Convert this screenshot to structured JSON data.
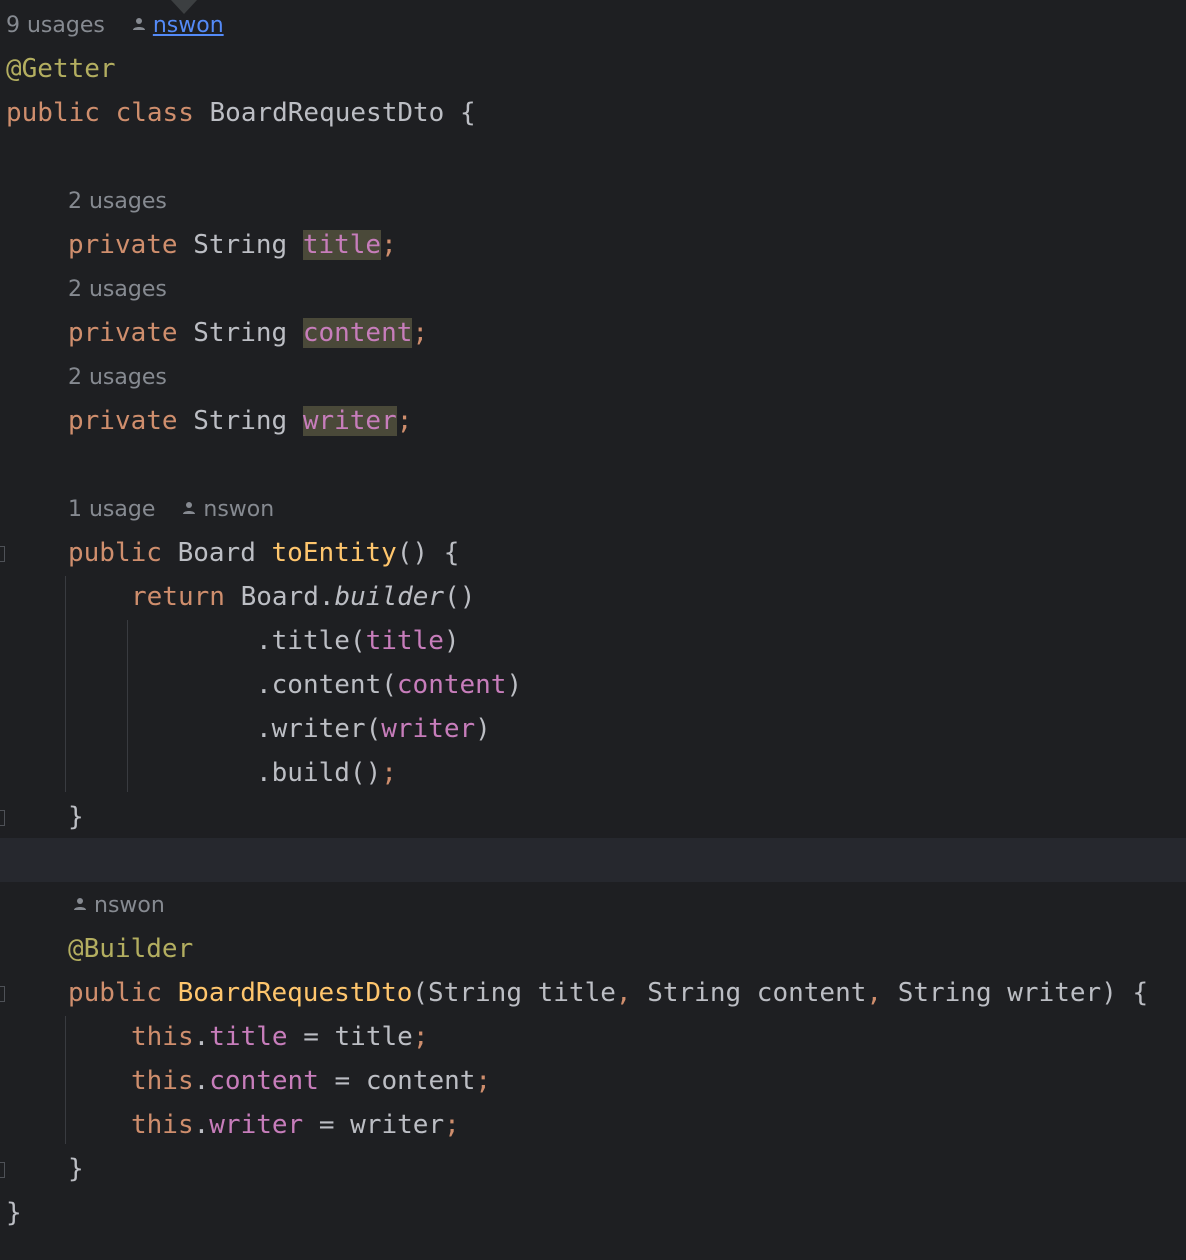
{
  "editor": {
    "colors": {
      "background": "#1e1f22",
      "keyword": "#cf8e6d",
      "annotation": "#b3ae60",
      "field": "#c77dbb",
      "method_declaration": "#ffc66d",
      "default_text": "#bcbec4",
      "hint_text": "#868a91",
      "link": "#548af7"
    },
    "hints": {
      "class_usages": "9 usages",
      "class_author": "nswon",
      "title_usages": "2 usages",
      "content_usages": "2 usages",
      "writer_usages": "2 usages",
      "toEntity_usages": "1 usage",
      "toEntity_author": "nswon",
      "constructor_author": "nswon"
    },
    "code": {
      "getter_annotation": "@Getter",
      "kw_public": "public",
      "kw_class": "class",
      "class_name": "BoardRequestDto",
      "open_brace": "{",
      "close_brace": "}",
      "kw_private": "private",
      "type_string": "String",
      "field_title": "title",
      "field_content": "content",
      "field_writer": "writer",
      "semicolon": ";",
      "type_board": "Board",
      "method_toEntity": "toEntity",
      "empty_parens": "()",
      "kw_return": "return",
      "board_builder_prefix": "Board.",
      "builder_call": "builder",
      "dot_title": ".title(",
      "dot_content": ".content(",
      "dot_writer": ".writer(",
      "close_paren": ")",
      "dot_build": ".build()",
      "builder_annotation": "@Builder",
      "ctor_open_paren": "(",
      "param_title": "title",
      "param_content": "content",
      "param_writer": "writer",
      "comma": ",",
      "ctor_close": ") {",
      "kw_this": "this",
      "dot": ".",
      "assign": " = "
    }
  }
}
